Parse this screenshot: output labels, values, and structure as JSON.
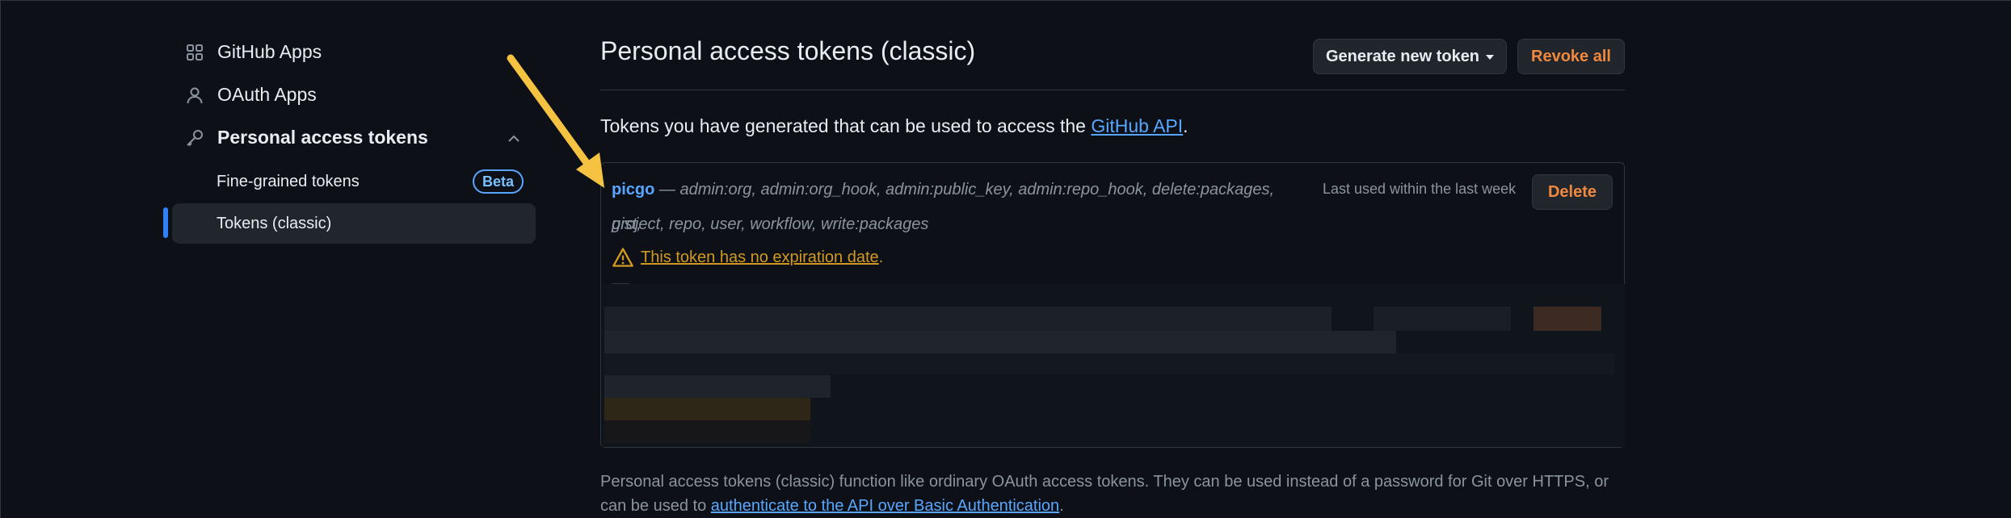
{
  "sidebar": {
    "items": [
      {
        "label": "GitHub Apps",
        "icon": "apps-icon"
      },
      {
        "label": "OAuth Apps",
        "icon": "person-icon"
      },
      {
        "label": "Personal access tokens",
        "icon": "key-icon"
      }
    ],
    "subitems": [
      {
        "label": "Fine-grained tokens",
        "badge": "Beta"
      },
      {
        "label": "Tokens (classic)"
      }
    ]
  },
  "main": {
    "title": "Personal access tokens (classic)",
    "generate_button": "Generate new token",
    "revoke_button": "Revoke all",
    "intro_prefix": "Tokens you have generated that can be used to access the ",
    "intro_link": "GitHub API",
    "intro_suffix": ".",
    "token": {
      "name": "picgo",
      "scopes_line1": " — admin:org, admin:org_hook, admin:public_key, admin:repo_hook, delete:packages, gist,",
      "scopes_line2": "project, repo, user, workflow, write:packages",
      "last_used": "Last used within the last week",
      "delete_button": "Delete",
      "warning": "This token has no expiration date",
      "warning_suffix": "."
    },
    "footer_text": "Personal access tokens (classic) function like ordinary OAuth access tokens. They can be used instead of a password for Git over HTTPS, or can be used to ",
    "footer_link": "authenticate to the API over Basic Authentication",
    "footer_suffix": "."
  },
  "colors": {
    "background": "#0d1117",
    "link": "#58a6ff",
    "danger": "#f0883e",
    "warning": "#d29922",
    "annotation_arrow": "#f5c242"
  }
}
